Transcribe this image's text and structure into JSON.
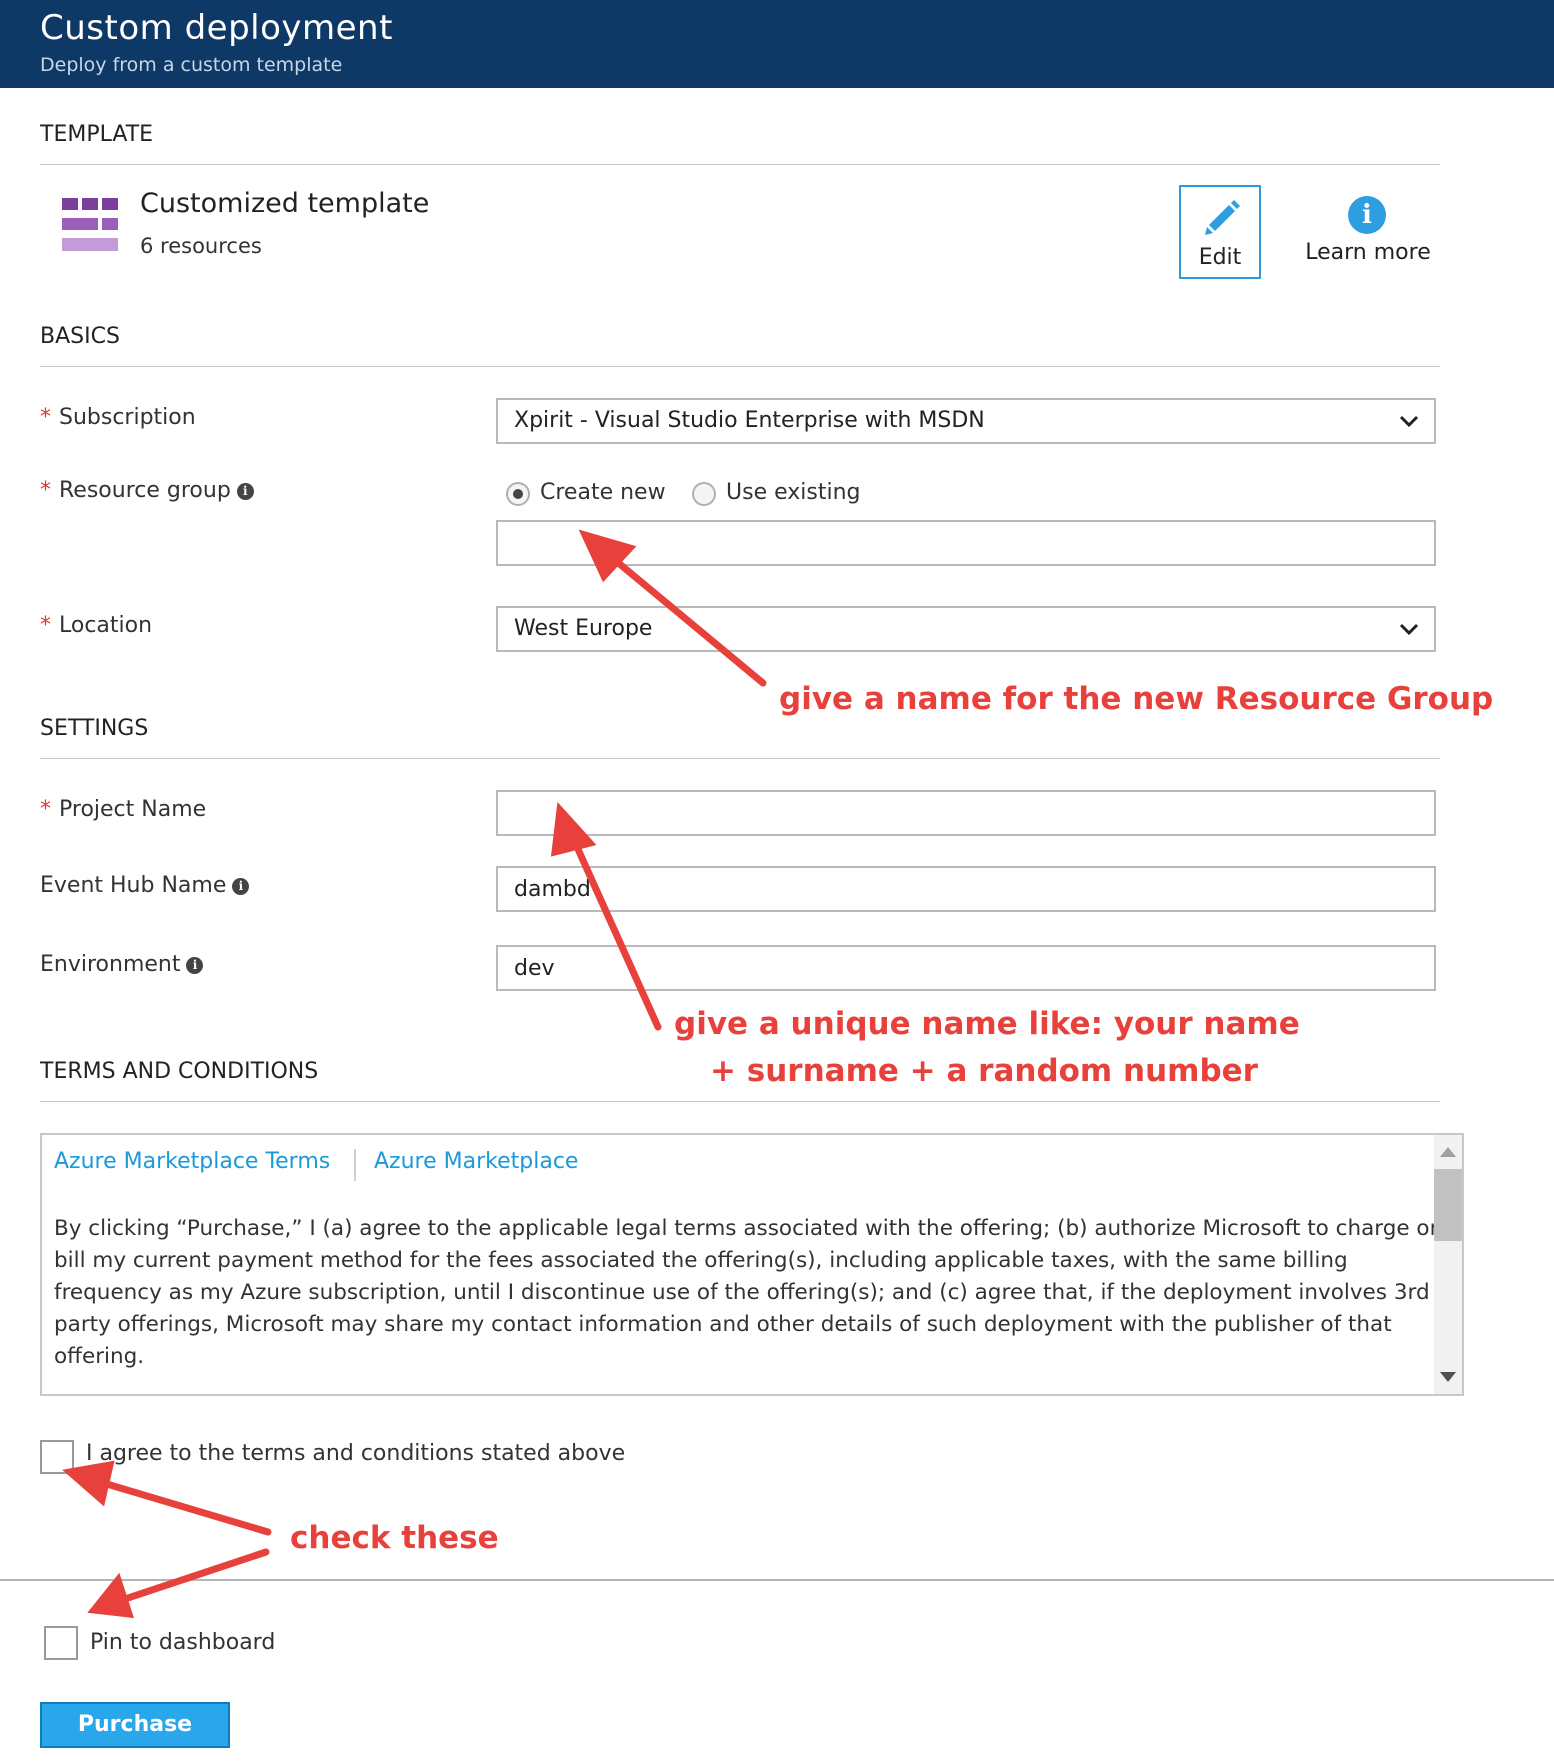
{
  "header": {
    "title": "Custom deployment",
    "subtitle": "Deploy from a custom template"
  },
  "template": {
    "section_title": "TEMPLATE",
    "name": "Customized template",
    "resources": "6 resources",
    "edit_label": "Edit",
    "learn_more_label": "Learn more",
    "icon": "template-grid-icon"
  },
  "basics": {
    "section_title": "BASICS",
    "subscription_label": "Subscription",
    "subscription_value": "Xpirit - Visual Studio Enterprise with MSDN",
    "resource_group_label": "Resource group",
    "radio_create_new": "Create new",
    "radio_use_existing": "Use existing",
    "resource_group_value": "",
    "location_label": "Location",
    "location_value": "West Europe"
  },
  "settings": {
    "section_title": "SETTINGS",
    "project_name_label": "Project Name",
    "project_name_value": "",
    "event_hub_label": "Event Hub Name",
    "event_hub_value": "dambd",
    "environment_label": "Environment",
    "environment_value": "dev"
  },
  "terms": {
    "section_title": "TERMS AND CONDITIONS",
    "tab_terms": "Azure Marketplace Terms",
    "tab_marketplace": "Azure Marketplace",
    "text": "By clicking “Purchase,” I (a) agree to the applicable legal terms associated with the offering; (b) authorize Microsoft to charge or bill my current payment method for the fees associated the offering(s), including applicable taxes, with the same billing frequency as my Azure subscription, until I discontinue use of the offering(s); and (c) agree that, if the deployment involves 3rd party offerings, Microsoft may share my contact information and other details of such deployment with the publisher of that offering.",
    "agree_label": "I agree to the terms and conditions stated above"
  },
  "footer": {
    "pin_label": "Pin to dashboard",
    "purchase_label": "Purchase"
  },
  "annotations": {
    "resource_group_note": "give a name for the new Resource Group",
    "unique_name_line1": "give a unique name like: your name",
    "unique_name_line2": "+ surname + a random number",
    "check_these": "check these"
  },
  "colors": {
    "header_bg": "#0e3866",
    "accent": "#2aa7ea",
    "link": "#1a9ad9",
    "required": "#d83b30",
    "annotation": "#e8413c"
  }
}
